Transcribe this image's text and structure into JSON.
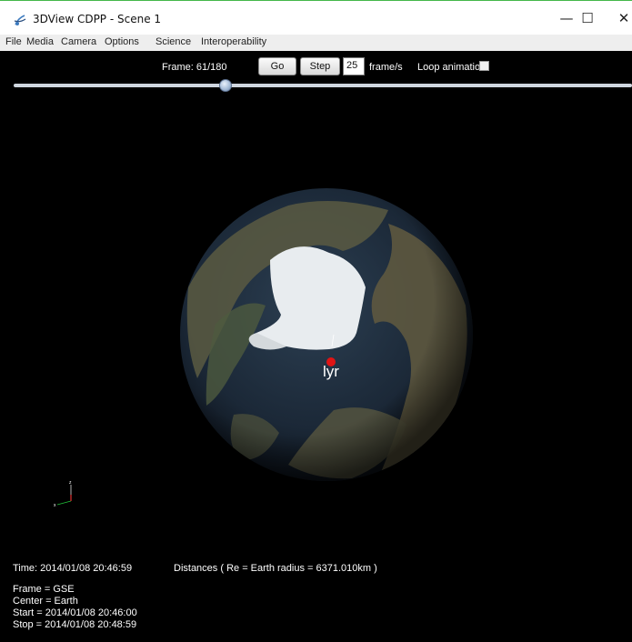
{
  "window": {
    "title": "3DView CDPP - Scene 1",
    "controls": {
      "minimize": "—",
      "maximize": "☐",
      "close": "✕"
    }
  },
  "menu": {
    "items": [
      "File",
      "Media",
      "Camera",
      "Options",
      "Science",
      "Interoperability"
    ]
  },
  "playback": {
    "frame_label": "Frame: 61/180",
    "go_label": "Go",
    "step_label": "Step",
    "fps_value": "25",
    "fps_unit": "frame/s",
    "loop_label": "Loop animation",
    "loop_checked": false,
    "frame_progress": 0.339
  },
  "scene": {
    "marker_label": "lyr",
    "marker_color": "#e01414",
    "axis_labels": {
      "z": "z",
      "x": "x"
    }
  },
  "info": {
    "time": "Time: 2014/01/08 20:46:59",
    "distances": "Distances ( Re = Earth radius = 6371.010km )",
    "frame": "Frame = GSE",
    "center": "Center = Earth",
    "start": "Start = 2014/01/08 20:46:00",
    "stop": "Stop = 2014/01/08 20:48:59"
  },
  "colors": {
    "background": "#000000",
    "titlebar_accent": "#44b84a",
    "ocean": "#1c2c3c",
    "ice": "#e8ecef",
    "land": "#5d5a44"
  },
  "icons": {
    "app": "3dview-app-icon",
    "loop_checkbox": "checkbox-icon",
    "slider": "slider-thumb-icon"
  }
}
